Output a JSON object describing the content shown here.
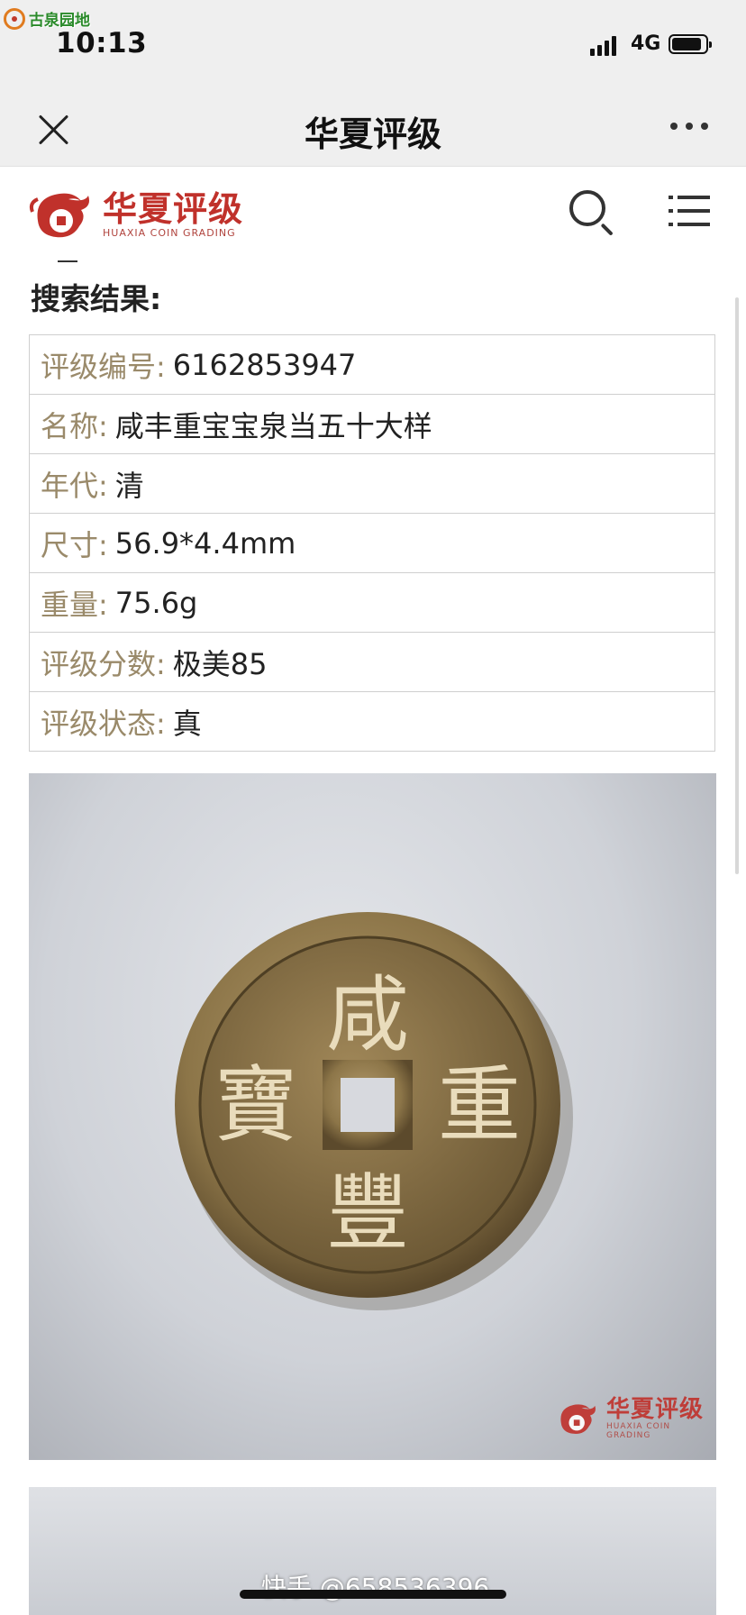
{
  "status_bar": {
    "watermark": "古泉园地",
    "time": "10:13",
    "network": "4G"
  },
  "nav": {
    "title": "华夏评级"
  },
  "brand": {
    "name_cn": "华夏评级",
    "name_en": "HUAXIA COIN GRADING"
  },
  "results": {
    "title": "搜索结果:",
    "rows": [
      {
        "label": "评级编号:",
        "value": "6162853947"
      },
      {
        "label": "名称:",
        "value": "咸丰重宝宝泉当五十大样"
      },
      {
        "label": "年代:",
        "value": "清"
      },
      {
        "label": "尺寸:",
        "value": "56.9*4.4mm"
      },
      {
        "label": "重量:",
        "value": "75.6g"
      },
      {
        "label": "评级分数:",
        "value": "极美85"
      },
      {
        "label": "评级状态:",
        "value": "真"
      }
    ]
  },
  "coin": {
    "chars": {
      "top": "咸",
      "bottom": "豐",
      "right": "重",
      "left": "寶"
    }
  },
  "overlay": {
    "kuaishou": "快手 @658536396"
  },
  "colors": {
    "brand_red": "#c0312b",
    "label_gold": "#9a8a6a"
  }
}
